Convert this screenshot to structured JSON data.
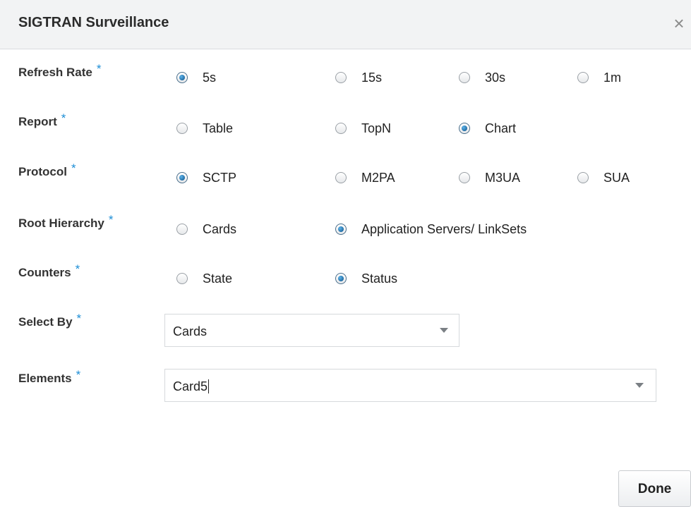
{
  "dialog": {
    "title": "SIGTRAN Surveillance",
    "close_glyph": "×"
  },
  "required_marker": "*",
  "fields": {
    "refresh_rate": {
      "label": "Refresh Rate",
      "options": [
        "5s",
        "15s",
        "30s",
        "1m"
      ],
      "selected": "5s"
    },
    "report": {
      "label": "Report",
      "options": [
        "Table",
        "TopN",
        "Chart"
      ],
      "selected": "Chart"
    },
    "protocol": {
      "label": "Protocol",
      "options": [
        "SCTP",
        "M2PA",
        "M3UA",
        "SUA"
      ],
      "selected": "SCTP"
    },
    "root_hierarchy": {
      "label": "Root Hierarchy",
      "options": [
        "Cards",
        "Application Servers/ LinkSets"
      ],
      "selected": "Application Servers/ LinkSets"
    },
    "counters": {
      "label": "Counters",
      "options": [
        "State",
        "Status"
      ],
      "selected": "Status"
    },
    "select_by": {
      "label": "Select By",
      "value": "Cards"
    },
    "elements": {
      "label": "Elements",
      "value": "Card5"
    }
  },
  "footer": {
    "done_label": "Done"
  },
  "colors": {
    "required": "#1d8ed6",
    "radio_selected": "#0b4f86",
    "header_bg": "#f2f3f4"
  }
}
